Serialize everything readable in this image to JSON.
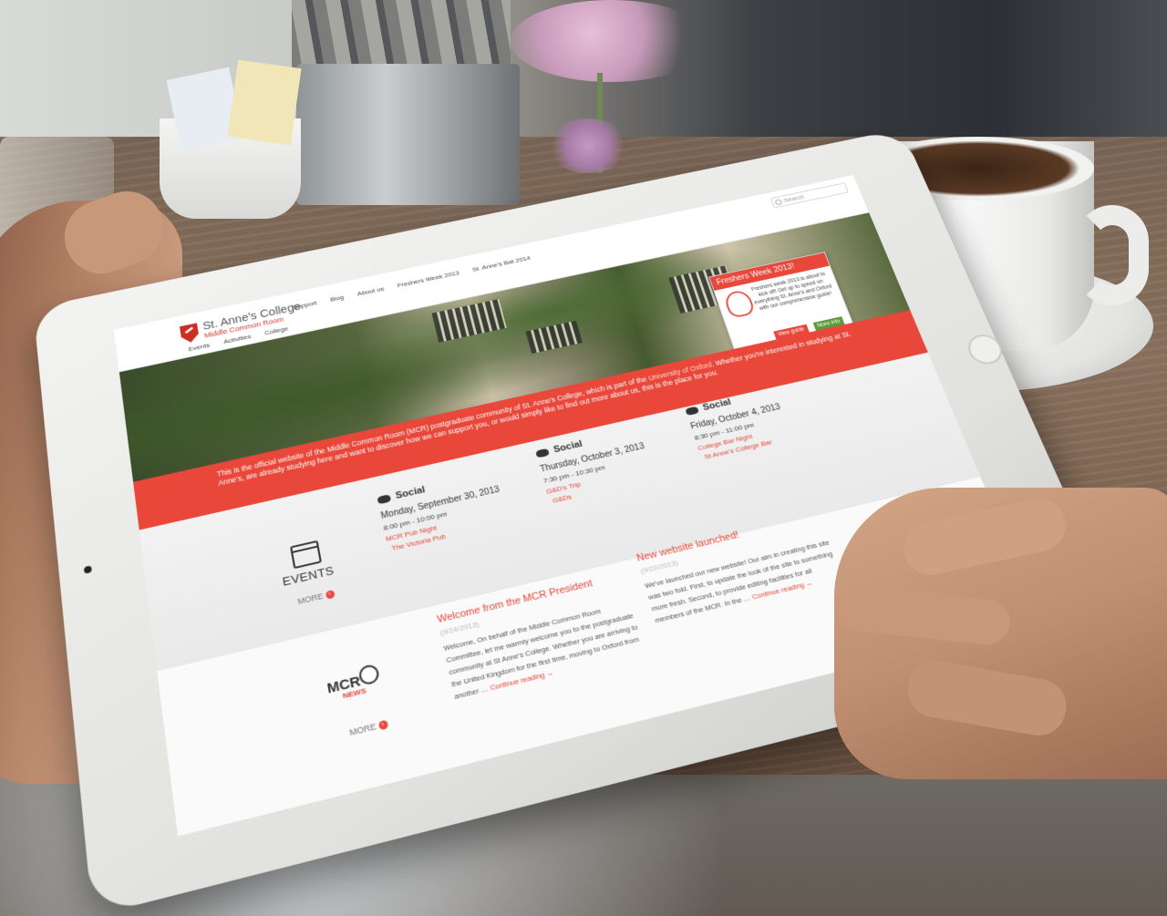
{
  "header": {
    "search_placeholder": "Search",
    "college_name": "St. Anne's College",
    "college_sub": "Middle Common Room",
    "nav_top": [
      "Support",
      "Blog",
      "About us",
      "Freshers Week 2013",
      "St. Anne's Bat 2014"
    ],
    "nav_bottom": [
      "Events",
      "Activities",
      "College"
    ]
  },
  "promo": {
    "title": "Freshers Week 2013!",
    "body": "Freshers week 2013 is about to kick off! Get up to speed on everything St. Anne's and Oxford with our comprehensive guide!",
    "btn_guide": "View guide",
    "btn_info": "More info"
  },
  "intro": {
    "text_a": "This is the official website of the Middle Common Room (MCR) postgraduate community of St. Anne's College, which is part of the ",
    "link": "University of Oxford",
    "text_b": ". Whether you're interested in studying at St. Anne's, are already studying here and want to discover how we can support you, or would simply like to find out more about us, this is the place for you."
  },
  "events": {
    "label": "EVENTS",
    "more": "MORE",
    "items": [
      {
        "type": "Social",
        "date": "Monday, September 30, 2013",
        "time": "8:00 pm - 10:00 pm",
        "name": "MCR Pub Night",
        "location": "The Victoria Pub"
      },
      {
        "type": "Social",
        "date": "Thursday, October 3, 2013",
        "time": "7:30 pm - 10:30 pm",
        "name": "G&D's Trip",
        "location": "G&Ds"
      },
      {
        "type": "Social",
        "date": "Friday, October 4, 2013",
        "time": "8:30 pm - 11:00 pm",
        "name": "College Bar Night",
        "location": "St Anne's College Bar"
      }
    ]
  },
  "news": {
    "logo_mcr": "MCR",
    "logo_news": "NEWS",
    "more": "MORE",
    "posts": [
      {
        "title": "Welcome from the MCR President",
        "date": "(9/24/2013)",
        "body": "Welcome,   On behalf of the Middle Common Room Committee, let me warmly welcome you to the postgraduate community at St Anne's College. Whether you are arriving to the United Kingdom for the first time, moving to Oxford from another …",
        "more": "Continue reading →"
      },
      {
        "title": "New website launched!",
        "date": "(9/22/2013)",
        "body": "We've launched our new website!   Our aim in creating this site was two fold. First, to update the look of the site to something more fresh. Second, to provide editing facilities for all members of the MCR. In the …",
        "more": "Continue reading →"
      }
    ]
  }
}
